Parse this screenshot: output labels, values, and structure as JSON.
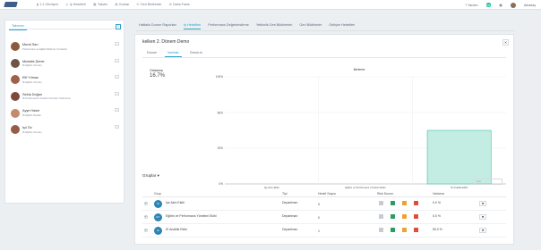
{
  "nav": {
    "items": [
      {
        "icon": "chart-icon",
        "label": "1:1 Görüşme"
      },
      {
        "icon": "target-icon",
        "label": "İş Hedefleri"
      },
      {
        "icon": "calendar-icon",
        "label": "Takvim"
      },
      {
        "icon": "book-icon",
        "label": "Kurslar"
      },
      {
        "icon": "mail-icon",
        "label": "Geri Bildirimler"
      },
      {
        "icon": "grid-icon",
        "label": "Daha Fazla"
      }
    ],
    "help": "Yardım",
    "badge": "40",
    "user": "Arkadaş"
  },
  "left": {
    "tab": "Takımım",
    "people": [
      {
        "name": "Murat Sarı",
        "role": "Performans ve Eğitim Bölümü Yöneticisi",
        "color": "#8b5a3c"
      },
      {
        "name": "Mustafa Şener",
        "role": "İK Eğitim Uzmanı",
        "color": "#6f5346"
      },
      {
        "name": "Elif Yılmaz",
        "role": "İK Eğitim Uzmanı",
        "color": "#a0614b"
      },
      {
        "name": "Selda Doğan",
        "role": "İK Performans Yönetimi Uzmanı Yardımcısı",
        "color": "#7b4a3a"
      },
      {
        "name": "Ayşe Haser",
        "role": "İK Eğitim Destek",
        "color": "#c28b6d"
      },
      {
        "name": "Işıl Öz",
        "role": "İK Eğitim Uzmanı",
        "color": "#955d45"
      }
    ]
  },
  "tabs": [
    "Haftalık Durum Raporları",
    "İş Hedefleri",
    "Performans Değerlendirme",
    "Yetkinlik Geri Bildirimleri",
    "Geri Bildirimler",
    "Gelişim Hedefleri"
  ],
  "active_tab": 1,
  "card": {
    "title": "kelken 2. Dönem Demo",
    "close": "✕",
    "subtabs": [
      "Durum",
      "Varlıklar",
      "Check-in"
    ],
    "active_subtab": 1,
    "avg_label": "Ortalama",
    "avg_value": "16.7%"
  },
  "chart_data": {
    "type": "bar",
    "title": "İlerleme",
    "categories": [
      "İşe Alım Ekibi",
      "Eğitim ve Performans Yönetimi Ekibi",
      "İK Analitik Ekibi"
    ],
    "values": [
      0,
      0,
      50
    ],
    "yticks": [
      "0%",
      "33%",
      "66%",
      "100%"
    ],
    "ylim": [
      0,
      100
    ],
    "bar_color": "#c3ede3",
    "bar_border": "#3fc3a3"
  },
  "groups": {
    "title": "Gruplar",
    "search_placeholder": "Ara",
    "headers": [
      "Grup",
      "Tipi",
      "Hedef Sayısı",
      "Risk Durum",
      "Varlama"
    ],
    "rows": [
      {
        "initials": "İA",
        "name": "İşe Alım Ekibi",
        "type": "Departman",
        "count": "0",
        "progress": "0.0 %"
      },
      {
        "initials": "EY",
        "name": "Eğitim ve Performans Yönetimi Ekibi",
        "type": "Departman",
        "count": "0",
        "progress": "0.0 %"
      },
      {
        "initials": "İA",
        "name": "İK Analitik Ekibi",
        "type": "Departman",
        "count": "1",
        "progress": "50.0 %"
      }
    ]
  }
}
